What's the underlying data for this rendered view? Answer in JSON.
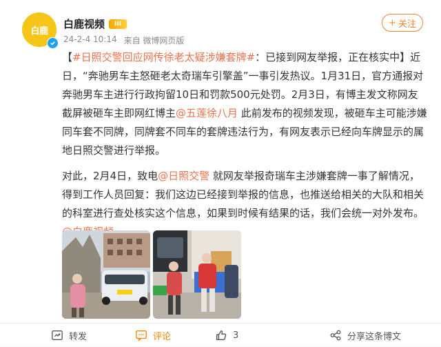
{
  "post": {
    "author": "白鹿视频",
    "badge": "III",
    "avatar_text": "白鹿",
    "time": "24-2-4 10:14",
    "source": "来自 微博网页版",
    "follow_label": "关注"
  },
  "content": {
    "p1_bracket_open": "【",
    "p1_hashtag": "#日照交警回应网传徐老太疑涉嫌套牌#",
    "p1_after_hashtag": "：已接到网友举报，正在核实中】近日，“奔驰男车主怒砸老太奇瑞车引擎盖”一事引发热议。1月31日，官方通报对奔驰男车主进行行政拘留10日和罚款500元处罚。2月3日，有博主发文称网友截屏被砸车主即网红博主",
    "p1_mention": "@五莲徐八月",
    "p1_tail": " 此前发布的视频发现，被砸车主可能涉嫌同车套不同牌，同牌套不同车的套牌违法行为，有网友表示已经向车牌显示的属地日照交警进行举报。",
    "p2_head": "对此，2月4日，致电",
    "p2_mention1": "@日照交警",
    "p2_middle": " 就网友举报奇瑞车主涉嫌套牌一事了解情况，得到工作人员回复：我们这边已经接到举报的信息，也推送给相关的大队和相关的科室进行查处核实这个信息，如果到时候有结果的话，我们会统一对外发布。",
    "p2_mention2": "@白鹿视频"
  },
  "toolbar": {
    "repost": "转发",
    "comment": "评论",
    "like_count": "3",
    "share": "分享这条博文"
  },
  "colors": {
    "accent": "#eb7350",
    "follow": "#f38535",
    "avatar": "#f5c518"
  }
}
